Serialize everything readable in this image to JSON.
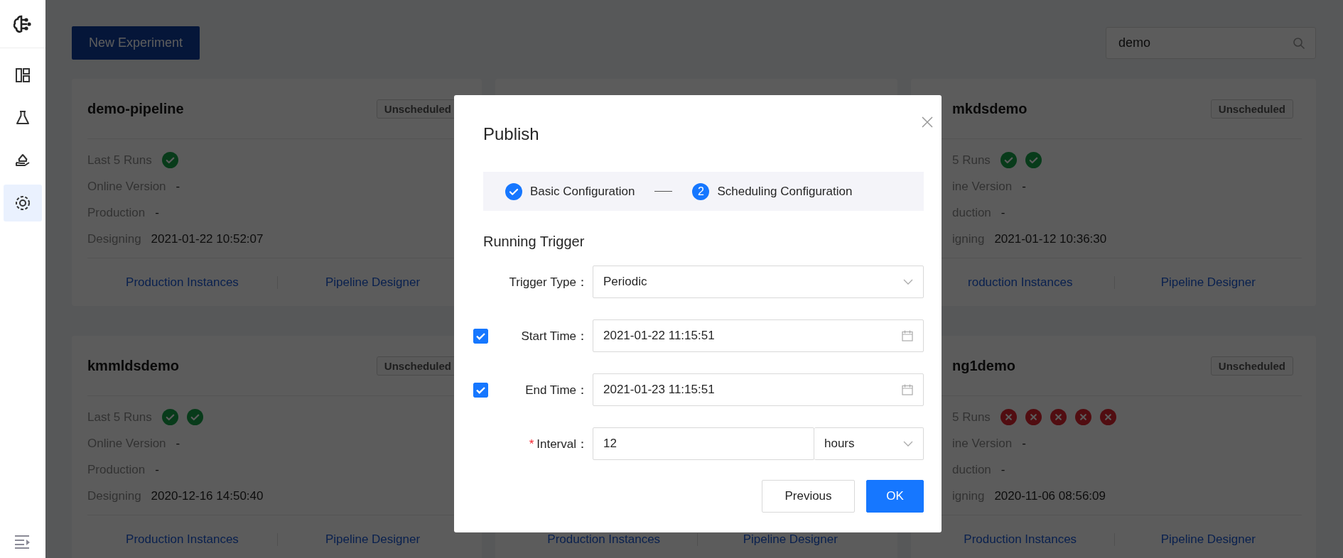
{
  "sidebar": {
    "items": [
      {
        "selected": false
      },
      {
        "selected": false
      },
      {
        "selected": false
      },
      {
        "selected": true
      }
    ]
  },
  "toolbar": {
    "new_button": "New Experiment",
    "search": {
      "value": "demo"
    }
  },
  "cards": [
    {
      "title": "demo-pipeline",
      "status": "Unscheduled",
      "runs_label": "Last 5 Runs",
      "runs": [
        {
          "failed": false
        }
      ],
      "rows": [
        {
          "label": "Online Version",
          "value": "-"
        },
        {
          "label": "Production",
          "value": "-"
        },
        {
          "label": "Designing",
          "value": "2021-01-22 10:52:07"
        }
      ],
      "links": [
        "Production Instances",
        "Pipeline Designer"
      ]
    },
    {
      "title": "mkdsdemo",
      "status": "Unscheduled",
      "runs_label": "5 Runs",
      "runs": [
        {
          "failed": false
        },
        {
          "failed": false
        }
      ],
      "rows": [
        {
          "label": "ine Version",
          "value": "-"
        },
        {
          "label": "duction",
          "value": "-"
        },
        {
          "label": "igning",
          "value": "2021-01-12 10:36:30"
        }
      ],
      "links": [
        "roduction Instances",
        "Pipeline Designer"
      ]
    },
    {
      "title": "kmmldsdemo",
      "status": "Unscheduled",
      "runs_label": "Last 5 Runs",
      "runs": [
        {
          "failed": false
        },
        {
          "failed": false
        }
      ],
      "rows": [
        {
          "label": "Online Version",
          "value": "-"
        },
        {
          "label": "Production",
          "value": "-"
        },
        {
          "label": "Designing",
          "value": "2020-12-16 14:50:40"
        }
      ],
      "links": [
        "Production Instances",
        "Pipeline Designer"
      ]
    },
    {
      "links": [
        "Production Instances",
        "Pipeline Designer"
      ]
    },
    {
      "title": "ng1demo",
      "status": "Unscheduled",
      "runs_label": "5 Runs",
      "runs": [
        {
          "failed": true
        },
        {
          "failed": true
        },
        {
          "failed": true
        },
        {
          "failed": true
        },
        {
          "failed": true
        }
      ],
      "rows": [
        {
          "label": "ine Version",
          "value": "-"
        },
        {
          "label": "duction",
          "value": "-"
        },
        {
          "label": "igning",
          "value": "2020-11-06 08:56:09"
        }
      ],
      "links": [
        "Production Instances",
        "Pipeline Designer"
      ]
    }
  ],
  "dialog": {
    "title": "Publish",
    "steps": [
      {
        "label": "Basic Configuration",
        "done": true
      },
      {
        "label": "Scheduling Configuration",
        "done": false,
        "number": "2"
      }
    ],
    "section_title": "Running Trigger",
    "fields": [
      {
        "kind": "select",
        "label": "Trigger Type：",
        "value": "Periodic"
      },
      {
        "kind": "date",
        "label": "Start Time：",
        "value": "2021-01-22 11:15:51",
        "checked": true
      },
      {
        "kind": "date",
        "label": "End Time：",
        "value": "2021-01-23 11:15:51",
        "checked": true
      },
      {
        "kind": "interval",
        "label": "Interval：",
        "required_mark": "*",
        "value": "12",
        "unit": "hours"
      }
    ],
    "buttons": [
      {
        "label": "Previous",
        "kind": "secondary"
      },
      {
        "label": "OK",
        "kind": "primary"
      }
    ]
  }
}
